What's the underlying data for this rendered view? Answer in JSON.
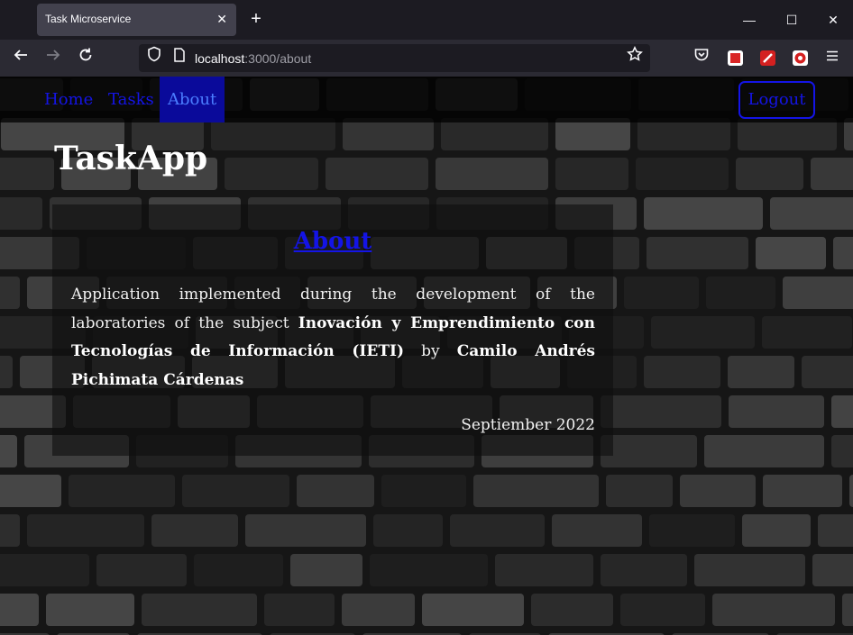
{
  "browser": {
    "tab_title": "Task Microservice",
    "tab_close_glyph": "✕",
    "new_tab_glyph": "+",
    "url_host": "localhost",
    "url_path": ":3000/about",
    "icons": [
      "back-icon",
      "forward-icon",
      "reload-icon",
      "shield-icon",
      "page-icon",
      "star-icon",
      "pocket-icon",
      "extension-icon",
      "menu-icon"
    ]
  },
  "window_controls": {
    "minimize": "—",
    "maximize": "☐",
    "close": "✕"
  },
  "app_nav": {
    "links": [
      "Home",
      "Tasks",
      "About"
    ],
    "active": "About",
    "logout_label": "Logout"
  },
  "brand": "TaskApp",
  "about": {
    "title": "About",
    "intro": "Application implemented during the development of the laboratories of the subject",
    "subject": "Inovación y Emprendimiento con Tecnologías de Información (IETI)",
    "by": "by",
    "author": "Camilo Andrés Pichimata Cárdenas",
    "date": "Septiember 2022"
  },
  "colors": {
    "link": "#1414e6",
    "active_bg": "#0a0a9a",
    "text": "#f2f2f2",
    "chrome_bg": "#1c1b22"
  }
}
